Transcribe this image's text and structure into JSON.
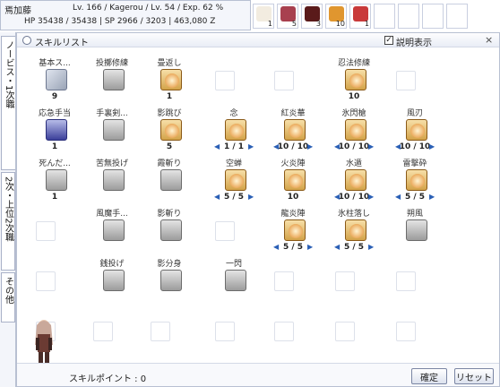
{
  "status": {
    "name": "焉加藤",
    "info": "Lv. 166 / Kagerou / Lv. 54 / Exp. 62 %",
    "hp_sp_line": "HP  35438 / 35438  |  SP  2966 / 3203  |  463,080 Z"
  },
  "hotbar": [
    {
      "icon": "feather-icon",
      "count": "1"
    },
    {
      "icon": "gem-icon",
      "count": "5"
    },
    {
      "icon": "kanji-icon",
      "count": "3"
    },
    {
      "icon": "scroll-icon",
      "count": "10"
    },
    {
      "icon": "orb-icon",
      "count": "1"
    },
    {
      "icon": "",
      "count": ""
    },
    {
      "icon": "",
      "count": ""
    },
    {
      "icon": "",
      "count": ""
    },
    {
      "icon": "",
      "count": ""
    }
  ],
  "side_tabs": [
    "ノービス・1次職",
    "2次・上位2次職",
    "その他"
  ],
  "window": {
    "title": "スキルリスト",
    "show_desc_checked": true,
    "show_desc_label": "説明表示",
    "close": "×"
  },
  "skills": [
    {
      "row": 0,
      "col": 0,
      "label": "基本ス...",
      "icon": "book",
      "level": "9"
    },
    {
      "row": 0,
      "col": 1,
      "label": "投擲修練",
      "icon": "lock",
      "level": ""
    },
    {
      "row": 0,
      "col": 2,
      "label": "畳返し",
      "icon": "scroll",
      "level": "1"
    },
    {
      "row": 0,
      "col": 5,
      "label": "忍法修練",
      "icon": "scroll",
      "level": "10"
    },
    {
      "row": 1,
      "col": 0,
      "label": "応急手当",
      "icon": "blue",
      "level": "1"
    },
    {
      "row": 1,
      "col": 1,
      "label": "手裏剣...",
      "icon": "lock",
      "level": ""
    },
    {
      "row": 1,
      "col": 2,
      "label": "影跳び",
      "icon": "scroll",
      "level": "5"
    },
    {
      "row": 1,
      "col": 3,
      "label": "念",
      "icon": "scroll",
      "level": "1 / 1",
      "arrows": true
    },
    {
      "row": 1,
      "col": 4,
      "label": "紅炎華",
      "icon": "scroll",
      "level": "10 / 10",
      "arrows": true
    },
    {
      "row": 1,
      "col": 5,
      "label": "氷閃槍",
      "icon": "scroll",
      "level": "10 / 10",
      "arrows": true
    },
    {
      "row": 1,
      "col": 6,
      "label": "風刃",
      "icon": "scroll",
      "level": "10 / 10",
      "arrows": true
    },
    {
      "row": 2,
      "col": 0,
      "label": "死んだ...",
      "icon": "lock",
      "level": "1"
    },
    {
      "row": 2,
      "col": 1,
      "label": "苦無投げ",
      "icon": "lock",
      "level": ""
    },
    {
      "row": 2,
      "col": 2,
      "label": "霞斬り",
      "icon": "lock",
      "level": ""
    },
    {
      "row": 2,
      "col": 3,
      "label": "空蝉",
      "icon": "scroll",
      "level": "5 / 5",
      "arrows": true
    },
    {
      "row": 2,
      "col": 4,
      "label": "火炎陣",
      "icon": "scroll",
      "level": "10",
      "arrows": false
    },
    {
      "row": 2,
      "col": 5,
      "label": "水遁",
      "icon": "scroll",
      "level": "10 / 10",
      "arrows": true
    },
    {
      "row": 2,
      "col": 6,
      "label": "雷撃砕",
      "icon": "scroll",
      "level": "5 / 5",
      "arrows": true
    },
    {
      "row": 3,
      "col": 1,
      "label": "風魔手...",
      "icon": "lock",
      "level": ""
    },
    {
      "row": 3,
      "col": 2,
      "label": "影斬り",
      "icon": "lock",
      "level": ""
    },
    {
      "row": 3,
      "col": 4,
      "label": "龍炎陣",
      "icon": "scroll",
      "level": "5 / 5",
      "arrows": true
    },
    {
      "row": 3,
      "col": 5,
      "label": "氷柱落し",
      "icon": "scroll",
      "level": "5 / 5",
      "arrows": true
    },
    {
      "row": 3,
      "col": 6,
      "label": "朔風",
      "icon": "lock",
      "level": ""
    },
    {
      "row": 4,
      "col": 1,
      "label": "銭投げ",
      "icon": "lock",
      "level": ""
    },
    {
      "row": 4,
      "col": 2,
      "label": "影分身",
      "icon": "lock",
      "level": ""
    },
    {
      "row": 4,
      "col": 3,
      "label": "一閃",
      "icon": "lock",
      "level": ""
    }
  ],
  "empty_slots": [
    [
      0,
      3
    ],
    [
      0,
      4
    ],
    [
      0,
      6
    ],
    [
      3,
      0
    ],
    [
      3,
      3
    ],
    [
      4,
      0
    ],
    [
      4,
      4
    ],
    [
      4,
      5
    ],
    [
      4,
      6
    ],
    [
      5,
      0
    ],
    [
      5,
      1
    ],
    [
      5,
      2
    ],
    [
      5,
      3
    ],
    [
      5,
      4
    ],
    [
      5,
      5
    ],
    [
      5,
      6
    ]
  ],
  "footer": {
    "skill_points": "スキルポイント : 0",
    "confirm": "確定",
    "reset": "リセット"
  }
}
